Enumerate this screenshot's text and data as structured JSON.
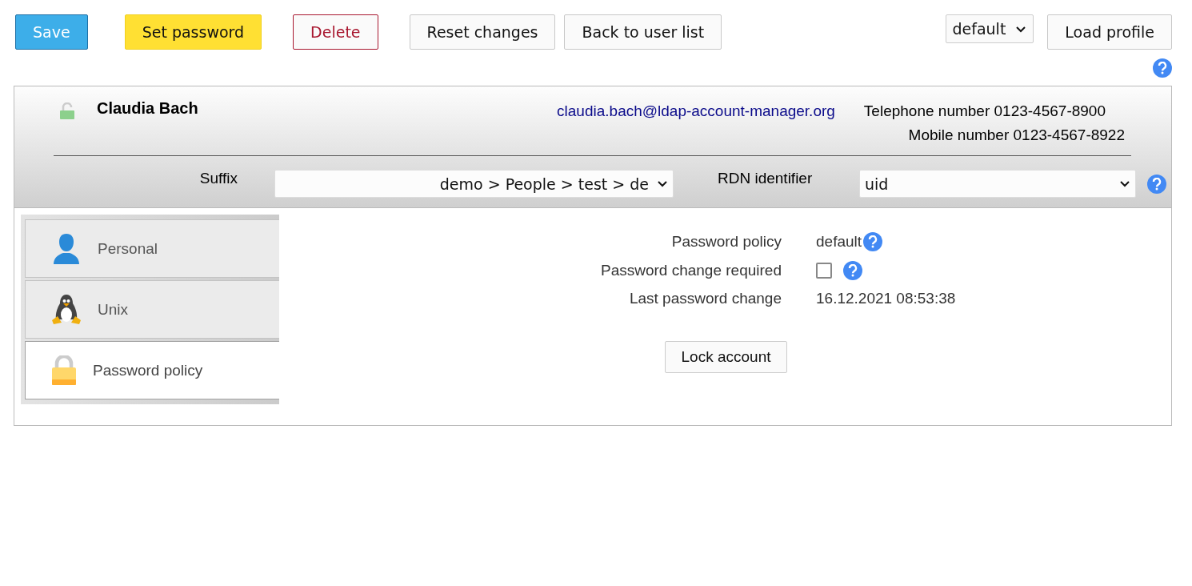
{
  "toolbar": {
    "button_groups": [
      [
        {
          "label": "Save",
          "kind": "primary"
        }
      ],
      [
        {
          "label": "Set password",
          "kind": "warning"
        }
      ],
      [
        {
          "label": "Delete",
          "kind": "danger"
        }
      ],
      [
        {
          "label": "Reset changes",
          "kind": "default"
        },
        {
          "label": "Back to user list",
          "kind": "default"
        }
      ]
    ],
    "profile_select": {
      "value": "default"
    },
    "load_button": "Load profile",
    "help": true
  },
  "header": {
    "locked": false,
    "name": "Claudia Bach",
    "email": "claudia.bach@ldap-account-manager.org",
    "contacts": [
      "Telephone number 0123-4567-8900",
      "Mobile number 0123-4567-8922"
    ],
    "suffix": {
      "label": "Suffix",
      "value": "demo > People > test > de"
    },
    "rdn": {
      "label": "RDN identifier",
      "value": "uid",
      "help": true
    }
  },
  "tabs": [
    {
      "label": "Personal",
      "kind": "person",
      "selected": false
    },
    {
      "label": "Unix",
      "kind": "penguin",
      "selected": false
    },
    {
      "label": "Password policy",
      "kind": "lock",
      "selected": true
    }
  ],
  "fields": [
    {
      "label": "Password policy",
      "kind": "text",
      "value": "default",
      "help": true
    },
    {
      "label": "Password change required",
      "kind": "checkbox",
      "checked": false,
      "help": true
    },
    {
      "label": "Last password change",
      "kind": "text",
      "value": "16.12.2021 08:53:38"
    }
  ],
  "action_button": "Lock account"
}
